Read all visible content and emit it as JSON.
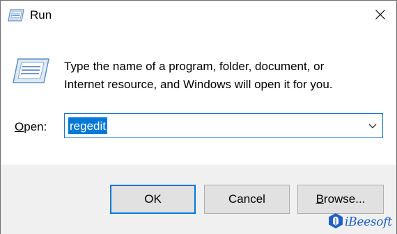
{
  "window": {
    "title": "Run"
  },
  "dialog": {
    "description_line1": "Type the name of a program, folder, document, or",
    "description_line2": "Internet resource, and Windows will open it for you.",
    "open_label_mnemonic": "O",
    "open_label_rest": "pen:",
    "open_value": "regedit"
  },
  "buttons": {
    "ok": "OK",
    "cancel": "Cancel",
    "browse_mnemonic": "B",
    "browse_rest": "rowse..."
  },
  "watermark": {
    "text": "iBeesoft"
  },
  "colors": {
    "selection": "#0078d7",
    "focus_border": "#0078d7",
    "footer_bg": "#f0f0f0",
    "button_bg": "#e1e1e1",
    "watermark": "#1e60c8"
  },
  "icons": {
    "title_icon": "run-icon",
    "dialog_icon": "run-icon",
    "close": "close-icon",
    "dropdown": "chevron-down-icon",
    "watermark_logo": "ibeesoft-logo-icon"
  }
}
